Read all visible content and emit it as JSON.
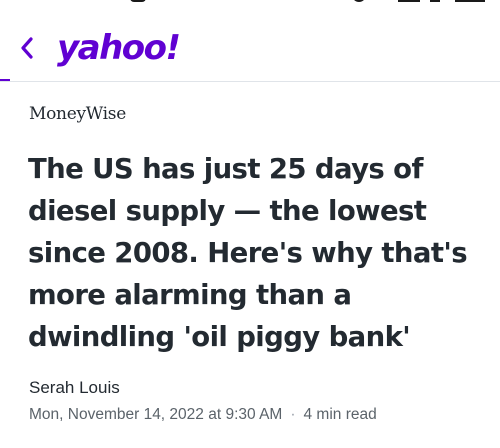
{
  "header": {
    "back_icon": "chevron-left-icon",
    "logo_text": "yahoo!",
    "brand_color": "#6001d2"
  },
  "article": {
    "publisher": "MoneyWise",
    "headline": "The US has just 25 days of diesel supply — the lowest since 2008. Here's why that's more alarming than a dwindling 'oil piggy bank'",
    "author": "Serah Louis",
    "date": "Mon, November 14, 2022 at 9:30 AM",
    "separator": "·",
    "read_time": "4 min read"
  }
}
